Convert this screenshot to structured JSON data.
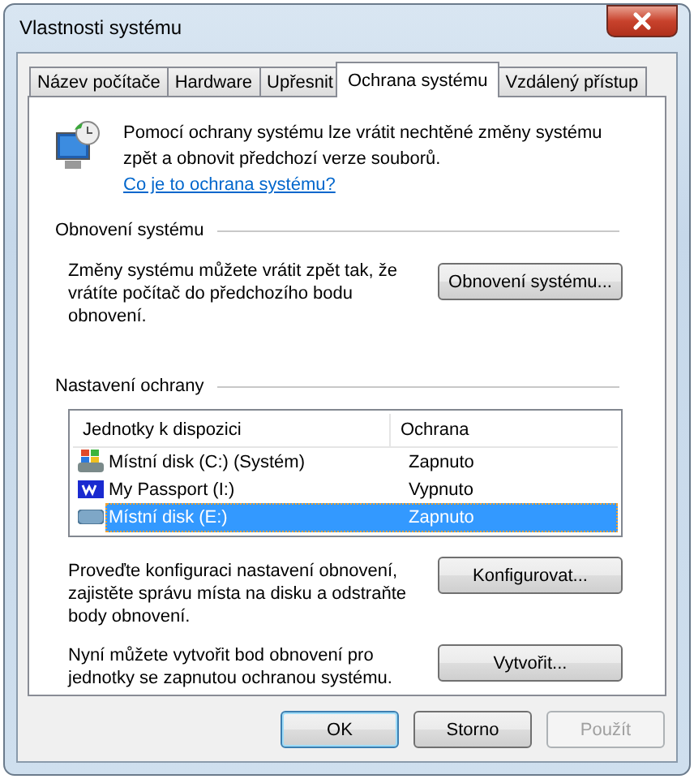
{
  "window": {
    "title": "Vlastnosti systému"
  },
  "tabs": [
    {
      "label": "Název počítače",
      "selected": false
    },
    {
      "label": "Hardware",
      "selected": false
    },
    {
      "label": "Upřesnit",
      "selected": false
    },
    {
      "label": "Ochrana systému",
      "selected": true
    },
    {
      "label": "Vzdálený přístup",
      "selected": false
    }
  ],
  "intro": {
    "text": "Pomocí ochrany systému lze vrátit nechtěné změny systému zpět a obnovit předchozí verze souborů.",
    "link": "Co je to ochrana systému?"
  },
  "restore": {
    "heading": "Obnovení systému",
    "text": "Změny systému můžete vrátit zpět tak, že vrátíte počítač do předchozího bodu obnovení.",
    "button": "Obnovení systému..."
  },
  "protection": {
    "heading": "Nastavení ochrany",
    "columns": [
      "Jednotky k dispozici",
      "Ochrana"
    ],
    "rows": [
      {
        "kind": "system",
        "name": "Místní disk (C:) (Systém)",
        "status": "Zapnuto",
        "selected": false
      },
      {
        "kind": "wd",
        "name": "My Passport (I:)",
        "status": "Vypnuto",
        "selected": false
      },
      {
        "kind": "disk",
        "name": "Místní disk (E:)",
        "status": "Zapnuto",
        "selected": true
      }
    ],
    "configure": {
      "text": "Proveďte konfiguraci nastavení obnovení, zajistěte správu místa na disku a odstraňte body obnovení.",
      "button": "Konfigurovat..."
    },
    "create": {
      "text": "Nyní můžete vytvořit bod obnovení pro jednotky se zapnutou ochranou systému.",
      "button": "Vytvořit..."
    }
  },
  "buttons": [
    {
      "label": "OK",
      "disabled": false,
      "default": true
    },
    {
      "label": "Storno",
      "disabled": false,
      "default": false
    },
    {
      "label": "Použít",
      "disabled": true,
      "default": false
    }
  ]
}
